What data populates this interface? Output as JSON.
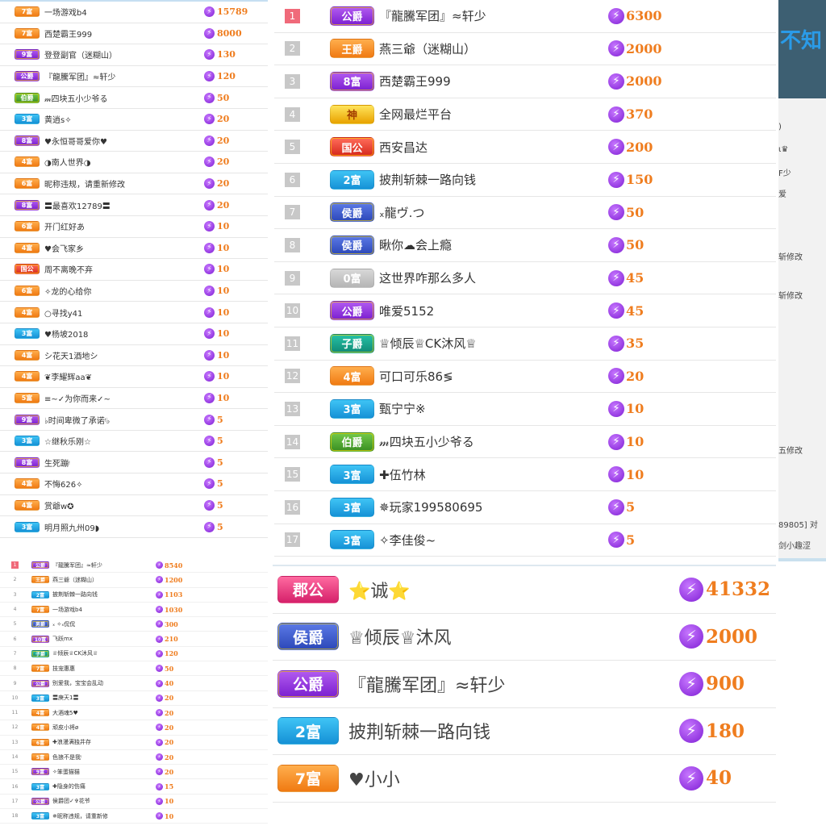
{
  "panel_a": {
    "rows": [
      {
        "badge": "7富",
        "color": "orange",
        "name": "一场游戏b4",
        "score": "15789"
      },
      {
        "badge": "7富",
        "color": "orange",
        "name": "西楚霸王999",
        "score": "8000"
      },
      {
        "badge": "9富",
        "color": "purple",
        "name": "登登副官（迷糊山）",
        "score": "130"
      },
      {
        "badge": "公爵",
        "color": "purple",
        "name": "『龍騰军团』≈轩少",
        "score": "120"
      },
      {
        "badge": "伯爵",
        "color": "green",
        "name": "𝓂四块五小少爷る",
        "score": "50"
      },
      {
        "badge": "3富",
        "color": "blue",
        "name": "黄逍s✧",
        "score": "20"
      },
      {
        "badge": "8富",
        "color": "purple",
        "name": "♥永恒哥哥爱你♥",
        "score": "20"
      },
      {
        "badge": "4富",
        "color": "orange",
        "name": "◑南人世界◑",
        "score": "20"
      },
      {
        "badge": "6富",
        "color": "orange",
        "name": "昵称违规，请重新修改",
        "score": "20"
      },
      {
        "badge": "8富",
        "color": "purple",
        "name": "〓最喜欢12789〓",
        "score": "20"
      },
      {
        "badge": "6富",
        "color": "orange",
        "name": "开门红好あ",
        "score": "10"
      },
      {
        "badge": "4富",
        "color": "orange",
        "name": "♥会飞家乡",
        "score": "10"
      },
      {
        "badge": "国公",
        "color": "red",
        "name": "周不离晚不弃",
        "score": "10"
      },
      {
        "badge": "6富",
        "color": "orange",
        "name": "✧龙的心给你",
        "score": "10"
      },
      {
        "badge": "4富",
        "color": "orange",
        "name": "○寻找y41",
        "score": "10"
      },
      {
        "badge": "3富",
        "color": "blue",
        "name": "♥杨坡2018",
        "score": "10"
      },
      {
        "badge": "4富",
        "color": "orange",
        "name": "シ花天1酒地シ",
        "score": "10"
      },
      {
        "badge": "4富",
        "color": "orange",
        "name": "❦李耀辉aa❦",
        "score": "10"
      },
      {
        "badge": "5富",
        "color": "orange",
        "name": "≡~✓为你而来✓~",
        "score": "10"
      },
      {
        "badge": "9富",
        "color": "purple",
        "name": "♭时间卑微了承诺ᵎ♭",
        "score": "5"
      },
      {
        "badge": "3富",
        "color": "blue",
        "name": "☆继秋乐刚☆",
        "score": "5"
      },
      {
        "badge": "8富",
        "color": "purple",
        "name": "生死蹦ᵎ",
        "score": "5"
      },
      {
        "badge": "4富",
        "color": "orange",
        "name": "不悔626✧",
        "score": "5"
      },
      {
        "badge": "4富",
        "color": "orange",
        "name": "赏爺w✪",
        "score": "5"
      },
      {
        "badge": "3富",
        "color": "blue",
        "name": "明月照九州09◗",
        "score": "5"
      }
    ]
  },
  "panel_b": {
    "rows": [
      {
        "rank": "1",
        "badge": "公爵",
        "color": "purple",
        "name": "『龍騰军团』≈轩少",
        "score": "6300"
      },
      {
        "rank": "2",
        "badge": "王爵",
        "color": "orange",
        "name": "燕三爺（迷糊山）",
        "score": "2000"
      },
      {
        "rank": "3",
        "badge": "8富",
        "color": "purple",
        "name": "西楚霸王999",
        "score": "2000"
      },
      {
        "rank": "4",
        "badge": "神",
        "color": "gold",
        "name": "全网最烂平台",
        "score": "370"
      },
      {
        "rank": "5",
        "badge": "国公",
        "color": "red",
        "name": "西安昌达",
        "score": "200"
      },
      {
        "rank": "6",
        "badge": "2富",
        "color": "blue",
        "name": "披荆斩棘一路向钱",
        "score": "150"
      },
      {
        "rank": "7",
        "badge": "侯爵",
        "color": "navy",
        "name": "ₓ龍ヴ.つ",
        "score": "50"
      },
      {
        "rank": "8",
        "badge": "侯爵",
        "color": "navy",
        "name": "瞅你☁会上瘾",
        "score": "50"
      },
      {
        "rank": "9",
        "badge": "0富",
        "color": "gray",
        "name": "这世界咋那么多人",
        "score": "45"
      },
      {
        "rank": "10",
        "badge": "公爵",
        "color": "purple",
        "name": "唯爱5152",
        "score": "45"
      },
      {
        "rank": "11",
        "badge": "子爵",
        "color": "teal",
        "name": "♕倾辰♕CK沐风♕",
        "score": "35"
      },
      {
        "rank": "12",
        "badge": "4富",
        "color": "orange",
        "name": "可口可乐86≶",
        "score": "20"
      },
      {
        "rank": "13",
        "badge": "3富",
        "color": "blue",
        "name": "甄宁宁※",
        "score": "10"
      },
      {
        "rank": "14",
        "badge": "伯爵",
        "color": "green",
        "name": "𝓂四块五小少爷る",
        "score": "10"
      },
      {
        "rank": "15",
        "badge": "3富",
        "color": "blue",
        "name": "✚伍竹林",
        "score": "10"
      },
      {
        "rank": "16",
        "badge": "3富",
        "color": "blue",
        "name": "✵玩家199580695",
        "score": "5"
      },
      {
        "rank": "17",
        "badge": "3富",
        "color": "blue",
        "name": "✧李佳俊~",
        "score": "5"
      }
    ]
  },
  "panel_c": {
    "rows": [
      {
        "rank": "1",
        "badge": "公爵",
        "color": "purple",
        "name": "『龍騰军团』≈轩少",
        "score": "8540"
      },
      {
        "rank": "2",
        "badge": "王爵",
        "color": "orange",
        "name": "燕三爺（迷糊山）",
        "score": "1200"
      },
      {
        "rank": "3",
        "badge": "2富",
        "color": "blue",
        "name": "披荆斩棘一路向钱",
        "score": "1103"
      },
      {
        "rank": "4",
        "badge": "7富",
        "color": "orange",
        "name": "一场游戏b4",
        "score": "1030"
      },
      {
        "rank": "5",
        "badge": "男爵",
        "color": "navy",
        "name": "ₓ ✧ₓ侃侃",
        "score": "300"
      },
      {
        "rank": "6",
        "badge": "10富",
        "color": "purple",
        "name": "飞跃mx",
        "score": "210"
      },
      {
        "rank": "7",
        "badge": "子爵",
        "color": "teal",
        "name": "♕倾辰♕CK沐风♕",
        "score": "120"
      },
      {
        "rank": "8",
        "badge": "7富",
        "color": "orange",
        "name": "技宠惠惠",
        "score": "50"
      },
      {
        "rank": "9",
        "badge": "公爵",
        "color": "purple",
        "name": "别爱我，宝宝会乱动",
        "score": "40"
      },
      {
        "rank": "10",
        "badge": "3富",
        "color": "blue",
        "name": "〓庚天1〓",
        "score": "20"
      },
      {
        "rank": "11",
        "badge": "4富",
        "color": "orange",
        "name": "大酒魂5♥",
        "score": "20"
      },
      {
        "rank": "12",
        "badge": "4富",
        "color": "orange",
        "name": "顽皮小将ø",
        "score": "20"
      },
      {
        "rank": "13",
        "badge": "6富",
        "color": "orange",
        "name": "✚浪漫满独井存",
        "score": "20"
      },
      {
        "rank": "14",
        "badge": "5富",
        "color": "orange",
        "name": "色狼不是我ᵎ",
        "score": "20"
      },
      {
        "rank": "15",
        "badge": "9富",
        "color": "purple",
        "name": "✧笨蛋猫猫",
        "score": "20"
      },
      {
        "rank": "16",
        "badge": "3富",
        "color": "blue",
        "name": "✚隐身的伤痛",
        "score": "15"
      },
      {
        "rank": "17",
        "badge": "公爵",
        "color": "purple",
        "name": "侯爵团✓✞花爷",
        "score": "10"
      },
      {
        "rank": "18",
        "badge": "3富",
        "color": "blue",
        "name": "✵昵称违规，请重新修",
        "score": "10"
      }
    ]
  },
  "panel_d": {
    "rows": [
      {
        "badge": "郡公",
        "color": "rose",
        "name": "⭐诚⭐",
        "score": "41332"
      },
      {
        "badge": "侯爵",
        "color": "navy",
        "name": "♕倾辰♕沐风",
        "score": "2000"
      },
      {
        "badge": "公爵",
        "color": "purple",
        "name": "『龍騰军团』≈轩少",
        "score": "900"
      },
      {
        "badge": "2富",
        "color": "blue",
        "name": "披荆斩棘一路向钱",
        "score": "180"
      },
      {
        "badge": "7富",
        "color": "orange",
        "name": "♥小小",
        "score": "40"
      }
    ]
  },
  "panel_e": {
    "header_text": "不知",
    "fragments": [
      ")",
      "ι♛",
      "F少",
      "爱",
      "斩修改",
      "斩修改",
      "五修改",
      "89805] 对",
      "剑小趣涩"
    ]
  },
  "icon": {
    "bolt": "lightning-bolt-icon",
    "bolt_glyph": "⚡"
  }
}
